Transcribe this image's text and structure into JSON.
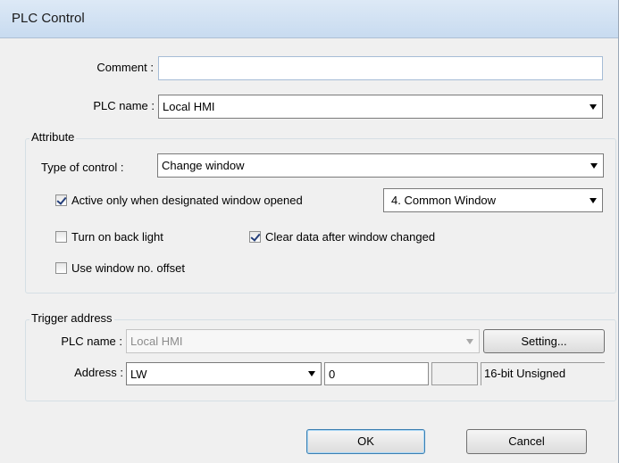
{
  "window": {
    "title": "PLC Control"
  },
  "top": {
    "comment_label": "Comment :",
    "comment_value": "",
    "plc_name_label": "PLC name :",
    "plc_name_value": "Local HMI"
  },
  "attribute": {
    "group_title": "Attribute",
    "type_label": "Type of control :",
    "type_value": "Change window",
    "active_only": {
      "label": "Active only when designated window opened",
      "checked": true
    },
    "window_select_value": "4. Common Window",
    "back_light": {
      "label": "Turn on back light",
      "checked": false
    },
    "clear_data": {
      "label": "Clear data after window changed",
      "checked": true
    },
    "window_offset": {
      "label": "Use window no. offset",
      "checked": false
    }
  },
  "trigger": {
    "group_title": "Trigger address",
    "plc_name_label": "PLC name :",
    "plc_name_value": "Local HMI",
    "setting_button": "Setting...",
    "address_label": "Address :",
    "address_device": "LW",
    "address_value": "0",
    "address_extra": "",
    "data_format": "16-bit Unsigned"
  },
  "footer": {
    "ok_label": "OK",
    "cancel_label": "Cancel"
  },
  "colors": {
    "title_bar": "#c8dbf0",
    "dialog_bg": "#f0f0f0",
    "default_button_border": "#3c7fb1"
  }
}
